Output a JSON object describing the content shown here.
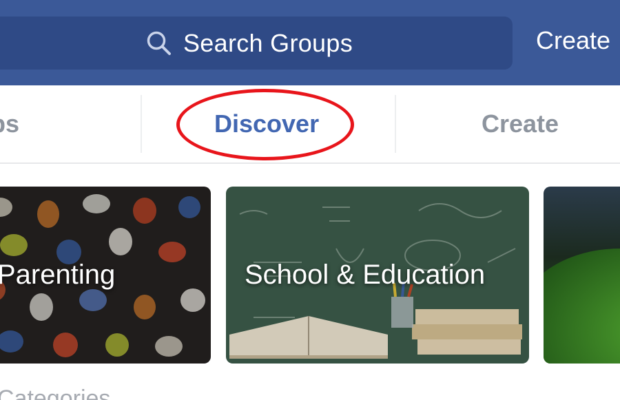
{
  "header": {
    "search_placeholder": "Search Groups",
    "search_icon": "search-icon",
    "create_label": "Create",
    "background_color": "#3b5998"
  },
  "tabs": [
    {
      "label": "Groups",
      "visible_text": "oups",
      "active": false
    },
    {
      "label": "Discover",
      "active": true
    },
    {
      "label": "Create",
      "active": false
    }
  ],
  "annotation": {
    "highlight_color": "#e8151b"
  },
  "cards": [
    {
      "label": "Parenting"
    },
    {
      "label": "School & Education"
    },
    {
      "label": ""
    }
  ],
  "section": {
    "title": "Categories"
  },
  "colors": {
    "active_tab": "#4267b2",
    "inactive_tab": "#8d949e"
  }
}
